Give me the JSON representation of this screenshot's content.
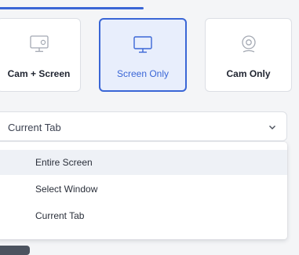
{
  "modes": [
    {
      "label": "Cam + Screen",
      "icon": "cam-screen-icon"
    },
    {
      "label": "Screen Only",
      "icon": "monitor-icon",
      "selected": true
    },
    {
      "label": "Cam Only",
      "icon": "webcam-icon"
    }
  ],
  "source_select": {
    "value": "Current Tab",
    "options": [
      "Entire Screen",
      "Select Window",
      "Current Tab"
    ]
  },
  "colors": {
    "accent": "#3a66d6",
    "selected_bg": "#e8eefc"
  }
}
